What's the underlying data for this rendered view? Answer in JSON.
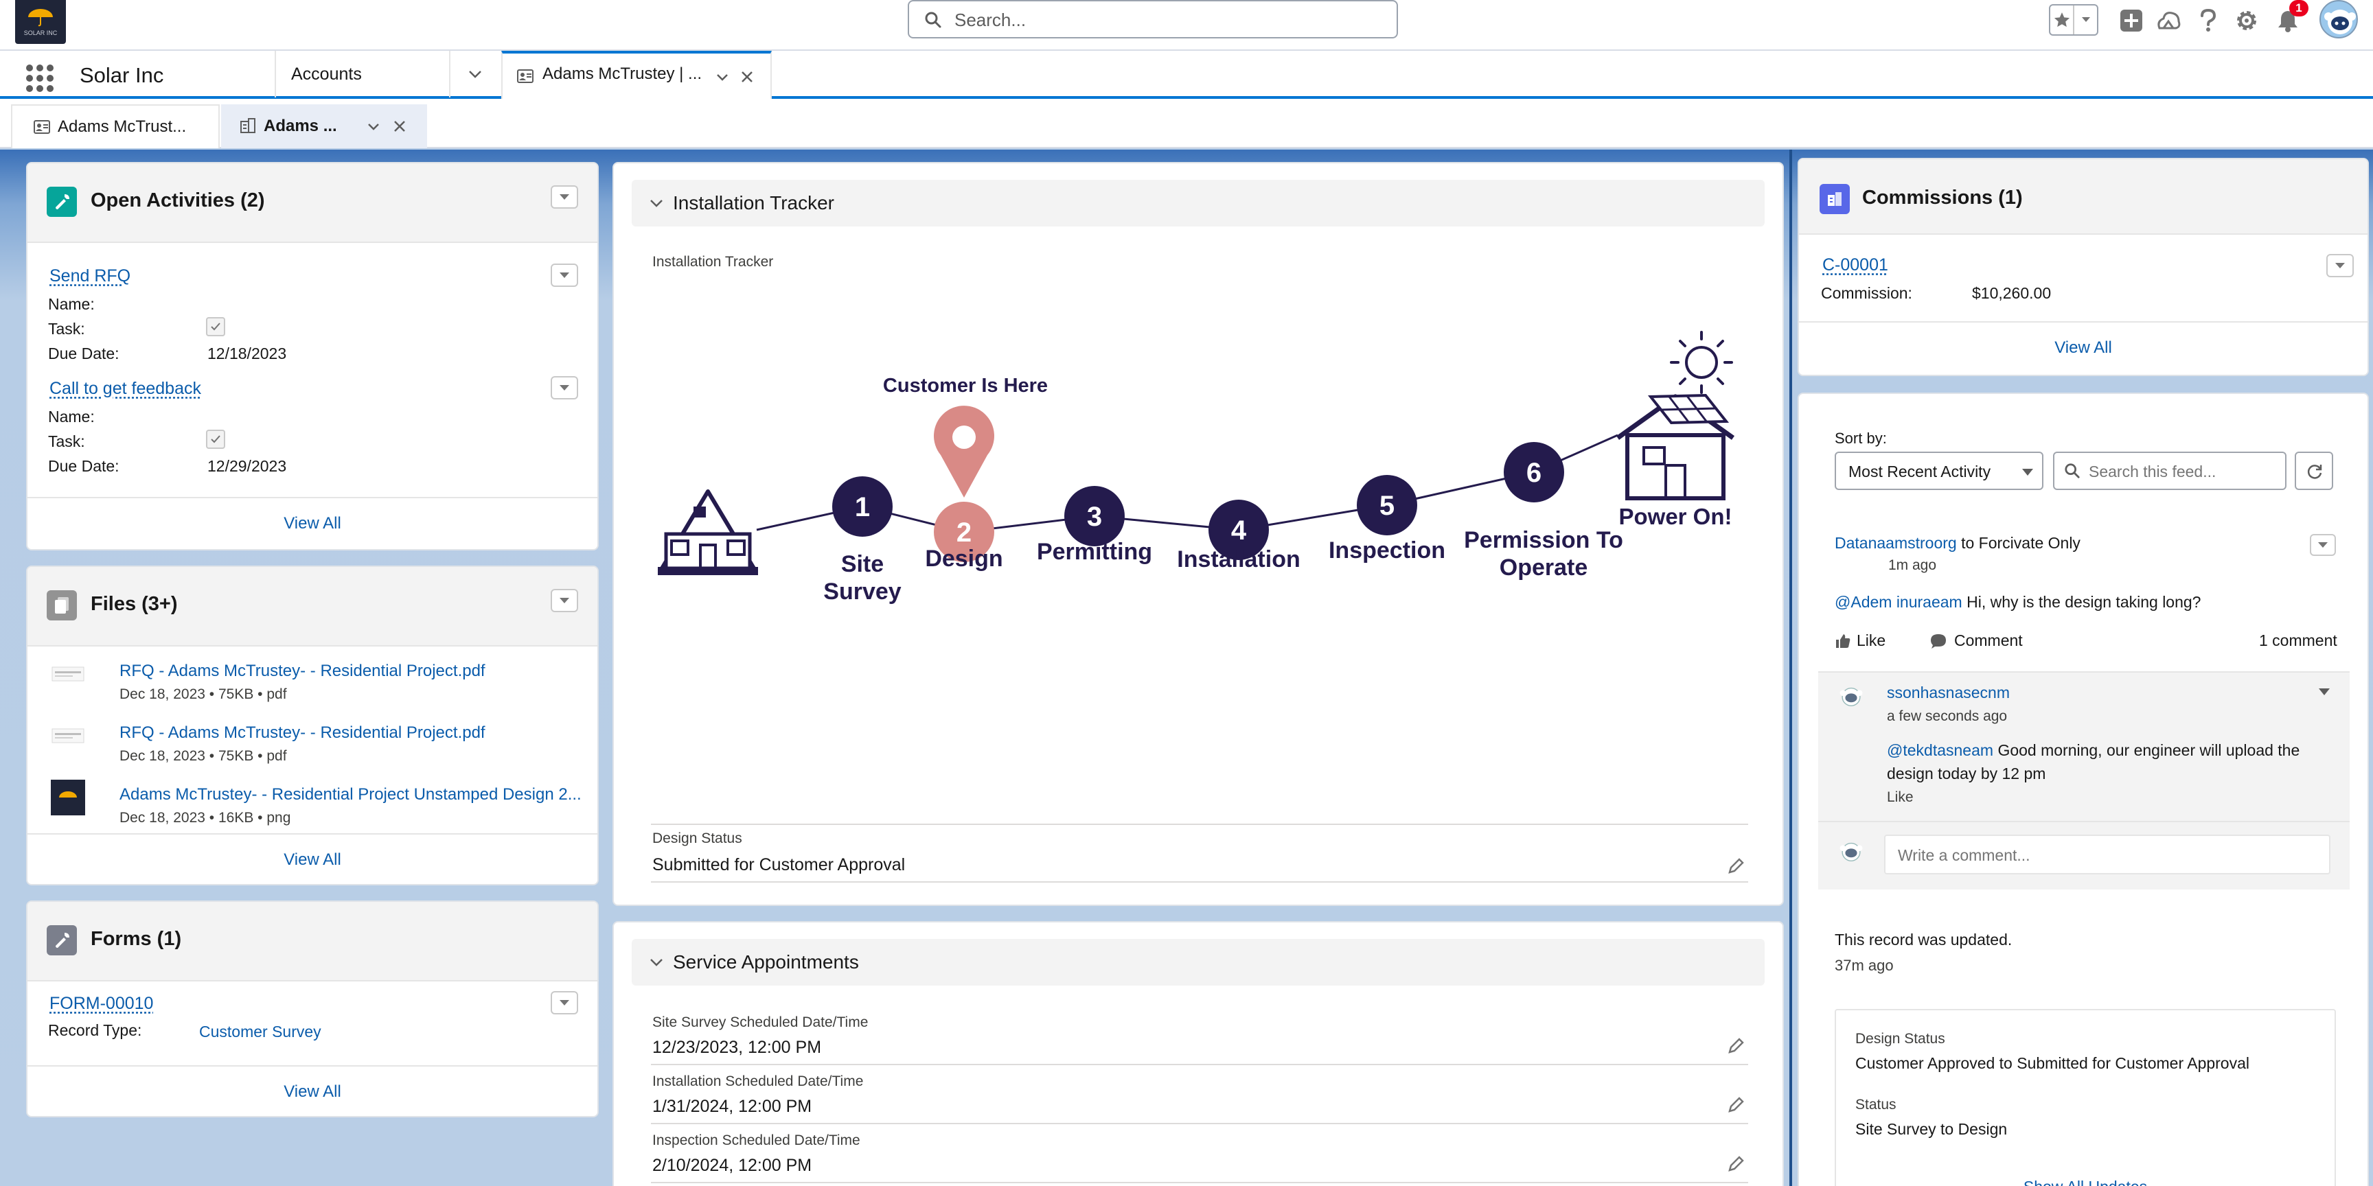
{
  "header": {
    "search_placeholder": "Search...",
    "notification_count": "1",
    "logo_caption": "SOLAR INC"
  },
  "app_nav": {
    "app_name": "Solar Inc",
    "accounts_label": "Accounts",
    "active_tab_label": "Adams McTrustey | ..."
  },
  "subtabs": [
    {
      "label": "Adams McTrust..."
    },
    {
      "label": "Adams ..."
    }
  ],
  "open_activities": {
    "title": "Open Activities (2)",
    "items": [
      {
        "link": "Send RFQ",
        "name_label": "Name:",
        "task_label": "Task:",
        "due_label": "Due Date:",
        "due_value": "12/18/2023"
      },
      {
        "link": "Call to get feedback",
        "name_label": "Name:",
        "task_label": "Task:",
        "due_label": "Due Date:",
        "due_value": "12/29/2023"
      }
    ],
    "view_all": "View All"
  },
  "files": {
    "title": "Files (3+)",
    "items": [
      {
        "name": "RFQ - Adams McTrustey- - Residential Project.pdf",
        "date": "Dec 18, 2023",
        "size": "75KB",
        "ext": "pdf"
      },
      {
        "name": "RFQ - Adams McTrustey- - Residential Project.pdf",
        "date": "Dec 18, 2023",
        "size": "75KB",
        "ext": "pdf"
      },
      {
        "name": "Adams McTrustey- - Residential Project Unstamped Design 2...",
        "date": "Dec 18, 2023",
        "size": "16KB",
        "ext": "png"
      }
    ],
    "view_all": "View All"
  },
  "forms": {
    "title": "Forms (1)",
    "item_link": "FORM-00010",
    "record_type_label": "Record Type:",
    "record_type_value": "Customer Survey",
    "view_all": "View All"
  },
  "installation_tracker": {
    "section_title": "Installation Tracker",
    "field_label": "Installation Tracker",
    "customer_marker": "Customer Is Here",
    "current_step": 2,
    "steps": [
      {
        "num": "1",
        "line1": "Site",
        "line2": "Survey"
      },
      {
        "num": "2",
        "line1": "Design",
        "line2": ""
      },
      {
        "num": "3",
        "line1": "Permitting",
        "line2": ""
      },
      {
        "num": "4",
        "line1": "Installation",
        "line2": ""
      },
      {
        "num": "5",
        "line1": "Inspection",
        "line2": ""
      },
      {
        "num": "6",
        "line1": "Permission To",
        "line2": "Operate"
      }
    ],
    "final_label": "Power On!",
    "design_status_label": "Design Status",
    "design_status_value": "Submitted for Customer Approval"
  },
  "service_appointments": {
    "section_title": "Service Appointments",
    "fields": [
      {
        "label": "Site Survey Scheduled Date/Time",
        "value": "12/23/2023, 12:00 PM"
      },
      {
        "label": "Installation Scheduled Date/Time",
        "value": "1/31/2024, 12:00 PM"
      },
      {
        "label": "Inspection Scheduled Date/Time",
        "value": "2/10/2024, 12:00 PM"
      }
    ]
  },
  "commissions": {
    "title": "Commissions (1)",
    "item_link": "C-00001",
    "commission_label": "Commission:",
    "commission_value": "$10,260.00",
    "view_all": "View All"
  },
  "feed": {
    "sort_label": "Sort by:",
    "sort_value": "Most Recent Activity",
    "search_placeholder": "Search this feed...",
    "post": {
      "author": "Datanaamstroorg",
      "visibility": "to Forcivate Only",
      "time": "1m ago",
      "mention": "@Adem inuraeam",
      "body": "Hi, why is the design taking long?",
      "like": "Like",
      "comment": "Comment",
      "comment_count": "1 comment"
    },
    "comment": {
      "author": "ssonhasnasecnm",
      "time": "a few seconds ago",
      "mention": "@tekdtasneam",
      "body": "Good morning, our engineer will upload the design today by 12 pm",
      "like": "Like"
    },
    "write_placeholder": "Write a comment...",
    "update": {
      "text": "This record was updated.",
      "time": "37m ago",
      "f1_label": "Design Status",
      "f1_value": "Customer Approved to Submitted for Customer Approval",
      "f2_label": "Status",
      "f2_value": "Site Survey to Design",
      "show_all": "Show All Updates"
    }
  },
  "colors": {
    "brand": "#0176d3",
    "tracker_navy": "#241b4d",
    "tracker_current": "#d98a86",
    "link": "#0b5cab",
    "activities_icon": "#06a59a",
    "files_icon": "#939393",
    "forms_icon": "#7b7f8c",
    "commissions_icon": "#5867e8"
  }
}
